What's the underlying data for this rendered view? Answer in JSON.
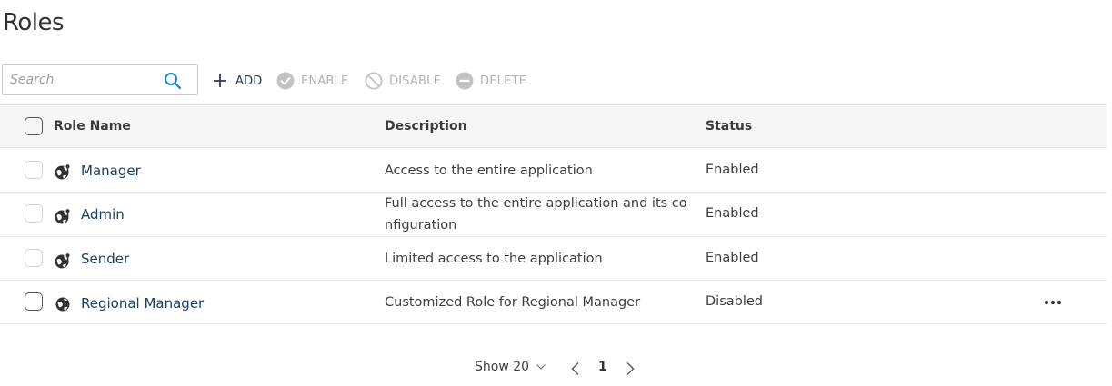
{
  "page": {
    "title": "Roles"
  },
  "search": {
    "placeholder": "Search",
    "value": ""
  },
  "toolbar": {
    "add": "ADD",
    "enable": "ENABLE",
    "disable": "DISABLE",
    "delete": "DELETE"
  },
  "table": {
    "columns": {
      "name": "Role Name",
      "description": "Description",
      "status": "Status"
    },
    "rows": [
      {
        "name": "Manager",
        "description": "Access to the entire application",
        "status": "Enabled",
        "icon": "globe-key-icon"
      },
      {
        "name": "Admin",
        "description": "Full access to the entire application and its configuration",
        "status": "Enabled",
        "icon": "globe-key-icon"
      },
      {
        "name": "Sender",
        "description": "Limited access to the application",
        "status": "Enabled",
        "icon": "globe-key-icon"
      },
      {
        "name": "Regional Manager",
        "description": "Customized Role for Regional Manager",
        "status": "Disabled",
        "icon": "globe-icon"
      }
    ]
  },
  "pagination": {
    "page_size_label": "Show 20",
    "current_page": "1"
  },
  "colors": {
    "accent": "#1a82c4",
    "link": "#1d3e63",
    "disabled": "#b3b3b3",
    "header_bg": "#f6f6f6"
  }
}
